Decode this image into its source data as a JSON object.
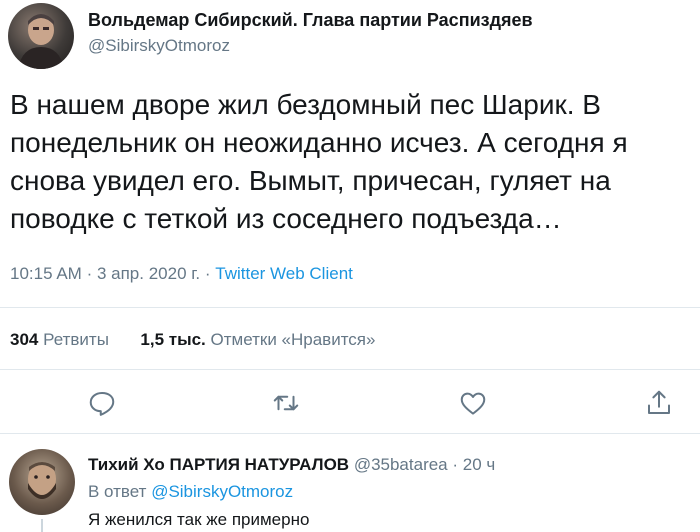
{
  "tweet": {
    "author_name": "Вольдемар Сибирский. Глава партии Распиздяев",
    "author_handle": "@SibirskyOtmoroz",
    "text": "В нашем дворе жил бездомный пес Шарик. В понедельник он неожиданно исчез. А сегодня я снова увидел его. Вымыт, причесан, гуляет на поводке с теткой из соседнего подъезда…",
    "time": "10:15 AM",
    "date": "3 апр. 2020 г.",
    "separator": "·",
    "client": "Twitter Web Client",
    "retweets_count": "304",
    "retweets_label": "Ретвиты",
    "likes_count": "1,5 тыс.",
    "likes_label": "Отметки «Нравится»"
  },
  "actions": [
    "reply-icon",
    "retweet-icon",
    "like-icon",
    "share-icon"
  ],
  "reply": {
    "author_name": "Тихий Хо ПАРТИЯ НАТУРАЛОВ",
    "author_handle": "@35batarea",
    "separator": "·",
    "time_ago": "20 ч",
    "reply_prefix": "В ответ",
    "reply_mention": "@SibirskyOtmoroz",
    "text": "Я женился так же примерно"
  },
  "colors": {
    "link": "#1b95e0",
    "secondary_text": "#657786",
    "primary_text": "#14171a",
    "divider": "#e1e8ed"
  }
}
